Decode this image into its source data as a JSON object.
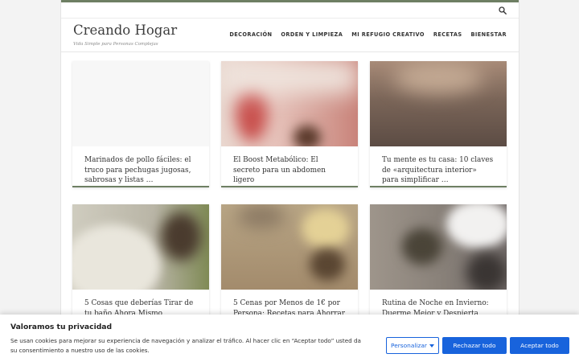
{
  "site": {
    "title": "Creando Hogar",
    "tagline": "Vida Simple para Personas Complejas"
  },
  "nav": [
    {
      "label": "DECORACIÓN"
    },
    {
      "label": "ORDEN Y LIMPIEZA"
    },
    {
      "label": "MI REFUGIO CREATIVO"
    },
    {
      "label": "RECETAS"
    },
    {
      "label": "BIENESTAR"
    }
  ],
  "posts": [
    {
      "title": "Marinados de pollo fáciles: el truco para pechugas jugosas, sabrosas y listas …"
    },
    {
      "title": "El Boost Metabólico: El secreto para un abdomen ligero"
    },
    {
      "title": "Tu mente es tu casa: 10 claves de «arquitectura interior» para simplificar …"
    },
    {
      "title": "5 Cosas que deberías Tirar de tu baño Ahora Mismo"
    },
    {
      "title": "5 Cenas por Menos de 1€ por Persona: Recetas para Ahorrar"
    },
    {
      "title": "Rutina de Noche en Invierno: Duerme Mejor y Despierta"
    }
  ],
  "cookie": {
    "title": "Valoramos tu privacidad",
    "text": "Se usan cookies para mejorar su experiencia de navegación y analizar el tráfico. Al hacer clic en “Aceptar todo” usted da su consentimiento a nuestro uso de las cookies.",
    "customize_label": "Personalizar",
    "reject_label": "Rechazar todo",
    "accept_label": "Aceptar todo"
  },
  "colors": {
    "accent": "#6e7f63",
    "button": "#1863dc"
  },
  "icons": {
    "search": "search-icon",
    "dropdown": "caret-down-icon"
  }
}
